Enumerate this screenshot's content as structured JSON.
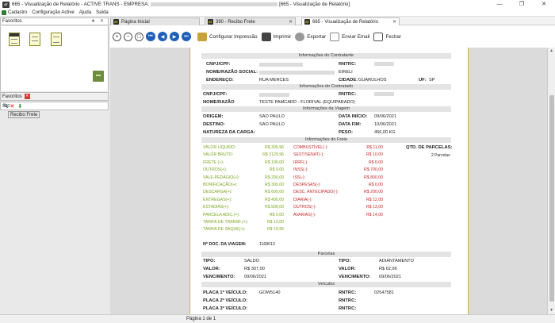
{
  "window": {
    "title_prefix": "665 - Visualização de Relatório - ACTIVE TRANS - EMPRESA:",
    "title_suffix": "[665 - Visualização de Relatório]",
    "controls": [
      "—",
      "❐",
      "✕"
    ]
  },
  "menu": [
    "Cadastro",
    "Configuração Active",
    "Ajuda",
    "Saída"
  ],
  "tabs": [
    {
      "label": "Página Inicial",
      "active": false
    },
    {
      "label": "390 - Recibo Frete",
      "active": false
    },
    {
      "label": "665 - Visualização de Relatório",
      "active": true
    }
  ],
  "favorites": {
    "header": "Favoritos",
    "tab_label": "Favoritos",
    "search_value": "390",
    "result": "Recibo Frete"
  },
  "toolbar": {
    "config_print": "Configurar Impressão",
    "print": "Imprimir",
    "export": "Exportar",
    "send_email": "Enviar Email",
    "close": "Fechar"
  },
  "report": {
    "contratante": {
      "header": "Informações do Contratante",
      "cnpj_label": "CNPJ/CPF:",
      "rntrc_label": "RNTRC:",
      "nome_label": "NOME/RAZÃO SOCIAL:",
      "nome_suffix": "EIRELI",
      "endereco_label": "ENDEREÇO:",
      "endereco": "RUA MERCES",
      "cidade_label": "CIDADE:",
      "cidade": "GUARULHOS",
      "uf_label": "UF:",
      "uf": "SP"
    },
    "contratado": {
      "header": "Informações do Contratado",
      "cnpj_label": "CNPJ/CPF:",
      "rntrc_label": "RNTRC:",
      "nome_label": "NOME/RAZÃO",
      "nome": "TESTE PAMCARD - FLORIVAL (EQUIPARADO)"
    },
    "viagem": {
      "header": "Informações da Viagem",
      "origem_label": "ORIGEM:",
      "origem": "SAO PAULO",
      "data_inicio_label": "DATA INÍCIO:",
      "data_inicio": "09/06/2021",
      "destino_label": "DESTINO:",
      "destino": "SAO PAULO",
      "data_fim_label": "DATA FIM:",
      "data_fim": "10/06/2021",
      "natureza_label": "NATUREZA DA CARGA:",
      "peso_label": "PESO:",
      "peso": "456,00 KG"
    },
    "frete": {
      "header": "Informações do Frete",
      "green": [
        {
          "label": "VALOR LÍQUIDO:",
          "value": "R$ 309,96"
        },
        {
          "label": "VALOR BRUTO:",
          "value": "R$ 2129,96"
        },
        {
          "label": "FRETE (+):",
          "value": "R$ 100,00"
        },
        {
          "label": "OUTROS(+):",
          "value": "R$ 0,00"
        },
        {
          "label": "VALE-PEDÁGIO(+):",
          "value": "R$ 200,00"
        },
        {
          "label": "BONIFICAÇÃO(+):",
          "value": "R$ 300,00"
        },
        {
          "label": "DESCARGA(+):",
          "value": "R$ 600,00"
        },
        {
          "label": "ENTREGAS(+):",
          "value": "R$ 400,00"
        },
        {
          "label": "ESTADIAS(+):",
          "value": "R$ 500,00"
        },
        {
          "label": "PARCELA ADIC.(+):",
          "value": "R$ 0,00"
        },
        {
          "label": "TARIFA DE TRANSF.(+):",
          "value": "R$ 10,00"
        },
        {
          "label": "TARIFA DE SAQUE(+):",
          "value": "R$ 19,96"
        }
      ],
      "red": [
        {
          "label": "COMBUSTÍVEL(-):",
          "value": "R$ 11,00"
        },
        {
          "label": "SEST/SENAT(-):",
          "value": "R$ 10,00"
        },
        {
          "label": "IRRF(-):",
          "value": "R$ 0,00"
        },
        {
          "label": "INSS(-):",
          "value": "R$ 700,00"
        },
        {
          "label": "ISS(-):",
          "value": "R$ 800,00"
        },
        {
          "label": "DESPESAS(-):",
          "value": "R$ 0,00"
        },
        {
          "label": "DESC. ANTECIPADO(-):",
          "value": "R$ 200,00"
        },
        {
          "label": "DIARIA(-):",
          "value": "R$ 12,00"
        },
        {
          "label": "OUTROS(-):",
          "value": "R$ 13,00"
        },
        {
          "label": "AVARIAS(-):",
          "value": "R$ 14,00"
        }
      ],
      "qtd_parcelas_label": "QTD. DE PARCELAS:",
      "qtd_parcelas": "2 Parcelas",
      "doc_viagem_label": "Nº DOC. DA VIAGEM:",
      "doc_viagem": "1168613"
    },
    "parcelas": {
      "header": "Parcelas",
      "items": [
        {
          "tipo_label": "TIPO:",
          "tipo": "SALDO",
          "valor_label": "VALOR:",
          "valor": "R$ 307,00",
          "venc_label": "VENCIMENTO:",
          "venc": "09/06/2021"
        },
        {
          "tipo_label": "TIPO:",
          "tipo": "ADIANTAMENTO",
          "valor_label": "VALOR:",
          "valor": "R$ 62,96",
          "venc_label": "VENCIMENTO:",
          "venc": "09/06/2021"
        }
      ]
    },
    "veiculos": {
      "header": "Veículos",
      "placa1_label": "PLACA 1º VEÍCULO:",
      "placa1": "GOW5140",
      "rntrc1_label": "RNTRC:",
      "rntrc1": "02547581",
      "placa2_label": "PLACA 2º VEÍCULO:",
      "rntrc2_label": "RNTRC:",
      "placa3_label": "PLACA 3º VEÍCULO:",
      "rntrc3_label": "RNTRC:"
    }
  },
  "status": {
    "page": "Página 1 de 1"
  }
}
